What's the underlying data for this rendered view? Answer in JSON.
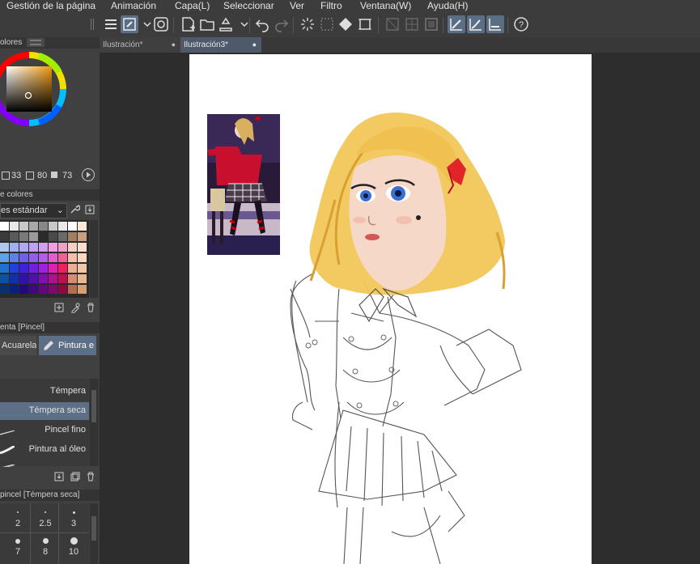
{
  "menu": [
    "Gestión de la página",
    "Animación",
    "Capa(L)",
    "Seleccionar",
    "Ver",
    "Filtro",
    "Ventana(W)",
    "Ayuda(H)"
  ],
  "color_panel": {
    "tab_label": "olores",
    "values": {
      "h": "33",
      "s": "80",
      "v": "73"
    },
    "selected_color": "#a8742a"
  },
  "palette": {
    "header": "e colores",
    "set_name": "es estándar",
    "colors": [
      [
        "#ffffff",
        "#e8e8e8",
        "#c8c8c8",
        "#a8a8a8",
        "#888888",
        "#c8c8c8",
        "#e8e8e8",
        "#ffffff",
        "#f8e8d8"
      ],
      [
        "#3a3a3a",
        "#5a5a5a",
        "#7a7a7a",
        "#9a9a9a",
        "#2a2a2a",
        "#4a4a4a",
        "#6a6a6a",
        "#a08060",
        "#c8a080"
      ],
      [
        "#b0c8f0",
        "#a0b0f0",
        "#b0a8f0",
        "#c0a0f0",
        "#d0a0f0",
        "#f0a0e0",
        "#f0a0c0",
        "#f8d0c0",
        "#f8e0d0"
      ],
      [
        "#60a0e8",
        "#6080e8",
        "#7060e8",
        "#9060e8",
        "#b060e8",
        "#e060d0",
        "#f06090",
        "#f0c0a8",
        "#f8d8c0"
      ],
      [
        "#2070d0",
        "#2040e0",
        "#4020e0",
        "#7020e0",
        "#a020e0",
        "#e020b0",
        "#f02060",
        "#e8b090",
        "#f0c8a8"
      ],
      [
        "#1050a0",
        "#1030b0",
        "#3010b0",
        "#5010b0",
        "#8010b0",
        "#b01090",
        "#c01050",
        "#d09070",
        "#e8b890"
      ],
      [
        "#083070",
        "#082080",
        "#200880",
        "#400880",
        "#600880",
        "#800870",
        "#900840",
        "#b07050",
        "#d8a070"
      ]
    ]
  },
  "tool_panel": {
    "header": "enta [Pincel]",
    "tabs": [
      "Acuarela",
      "Pintura e"
    ]
  },
  "brushes": [
    "Témpera",
    "Témpera seca",
    "Pincel fino",
    "Pintura al óleo"
  ],
  "brush_size_panel": {
    "header": "pincel [Témpera seca]",
    "sizes": [
      "2",
      "2.5",
      "3",
      "7",
      "8",
      "10"
    ]
  },
  "doc_tabs": [
    "Ilustración*",
    "Ilustración3*"
  ]
}
